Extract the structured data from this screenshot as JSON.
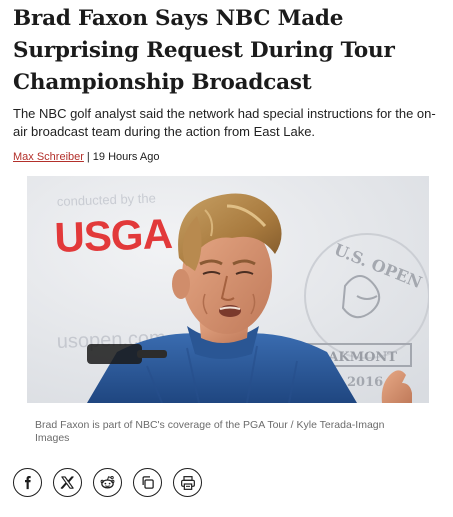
{
  "article": {
    "headline": "Brad Faxon Says NBC Made Surprising Request During Tour Championship Broadcast",
    "dek": "The NBC golf analyst said the network had special instructions for the on-air broadcast team during the action from East Lake.",
    "author": "Max Schreiber",
    "separator": "|",
    "timestamp": "19 Hours Ago"
  },
  "photo": {
    "backdrop_texts": {
      "conducted_by": "conducted by the",
      "usga": "USGA",
      "website": "usopen.com",
      "us_open": "U.S. OPEN",
      "oakmont": "OAKMONT",
      "year": "2016"
    },
    "colors": {
      "usga_red": "#e2393a",
      "usga_blue": "#1f4e8c",
      "backdrop": "#e8eaed",
      "shirt": "#2f5f9f"
    }
  },
  "caption": "Brad Faxon is part of NBC's coverage of the PGA Tour / Kyle Terada-Imagn Images",
  "share": {
    "buttons": [
      {
        "name": "facebook",
        "icon": "facebook-icon"
      },
      {
        "name": "x",
        "icon": "x-icon"
      },
      {
        "name": "reddit",
        "icon": "reddit-icon"
      },
      {
        "name": "copy-link",
        "icon": "copy-icon"
      },
      {
        "name": "print",
        "icon": "print-icon"
      }
    ]
  }
}
